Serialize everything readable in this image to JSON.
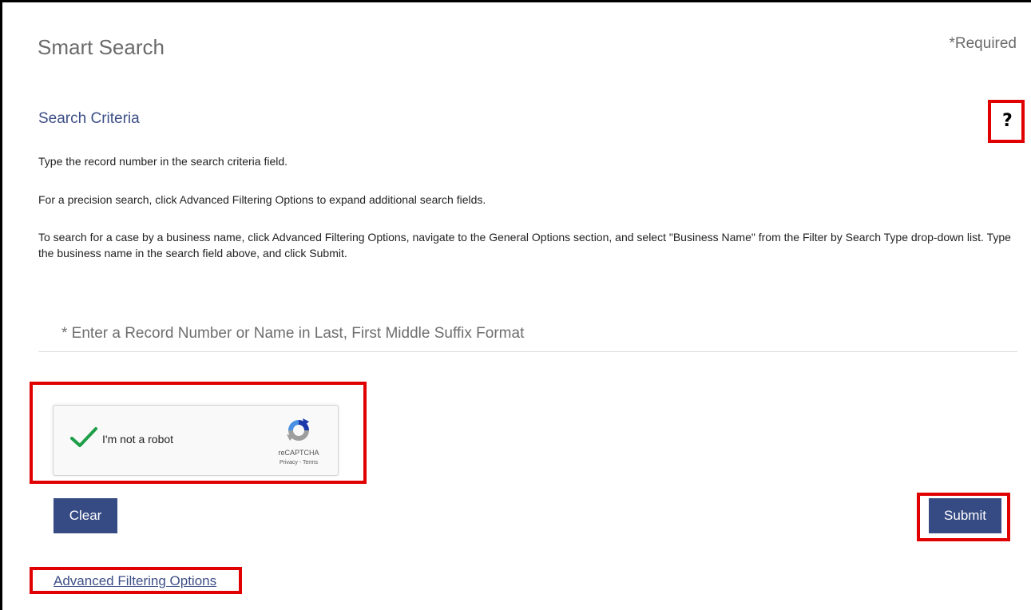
{
  "header": {
    "title": "Smart Search",
    "required_note": "*Required"
  },
  "search_criteria": {
    "heading": "Search Criteria",
    "help_symbol": "?",
    "instructions": [
      "Type the record number in the search criteria field.",
      "For a precision search, click Advanced Filtering Options to expand additional search fields.",
      "To search for a case by a business name, click Advanced Filtering Options, navigate to the General Options section, and select \"Business Name\" from the Filter by Search Type drop-down list. Type the business name in the search field above, and click Submit."
    ],
    "input_placeholder": "* Enter a Record Number or Name in Last, First Middle Suffix Format",
    "input_value": ""
  },
  "captcha": {
    "label": "I'm not a robot",
    "checked": true,
    "brand": "reCAPTCHA",
    "links": "Privacy - Terms"
  },
  "actions": {
    "clear_label": "Clear",
    "submit_label": "Submit",
    "advanced_link": "Advanced Filtering Options"
  },
  "colors": {
    "accent": "#364b84",
    "heading": "#3c4f87",
    "highlight": "#e00000",
    "check": "#1e9e48"
  }
}
